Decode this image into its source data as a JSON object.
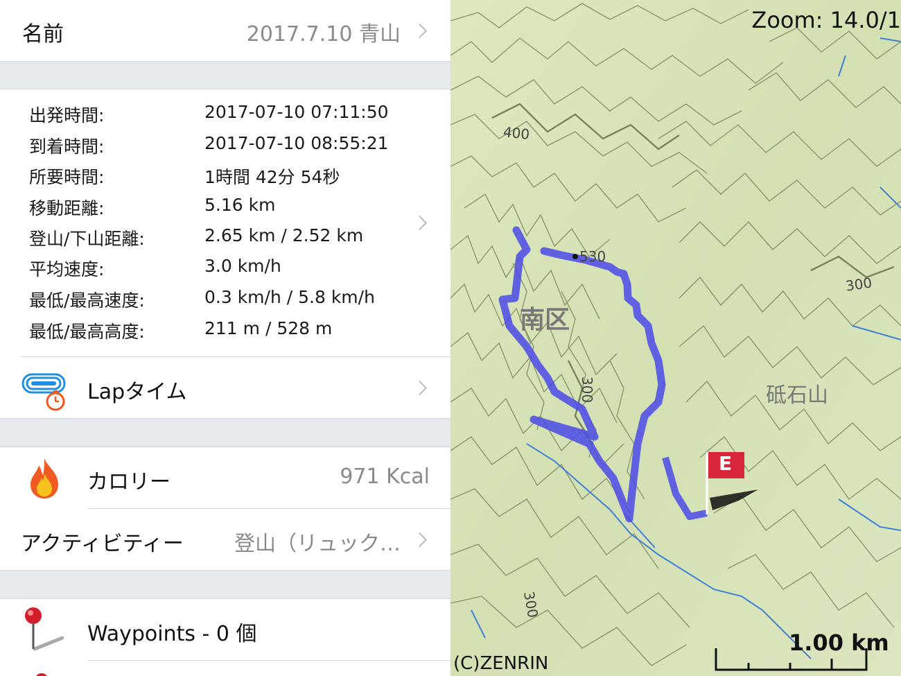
{
  "name_row": {
    "label": "名前",
    "value": "2017.7.10 青山"
  },
  "stats": [
    {
      "label": "出発時間:",
      "value": "2017-07-10 07:11:50"
    },
    {
      "label": "到着時間:",
      "value": "2017-07-10 08:55:21"
    },
    {
      "label": "所要時間:",
      "value": "1時間 42分 54秒"
    },
    {
      "label": "移動距離:",
      "value": "5.16 km"
    },
    {
      "label": "登山/下山距離:",
      "value": "2.65 km / 2.52 km"
    },
    {
      "label": "平均速度:",
      "value": "3.0 km/h"
    },
    {
      "label": "最低/最高速度:",
      "value": "0.3 km/h / 5.8 km/h"
    },
    {
      "label": "最低/最高高度:",
      "value": "211 m / 528 m"
    }
  ],
  "lap": {
    "label": "Lapタイム",
    "icon": "stopwatch-track-icon"
  },
  "calorie": {
    "label": "カロリー",
    "value": "971 Kcal",
    "icon": "flame-icon"
  },
  "activity": {
    "label": "アクティビティー",
    "value": "登山（リュック…"
  },
  "waypoints": {
    "label": "Waypoints - 0 個",
    "icon": "map-pin-icon"
  },
  "map": {
    "zoom": "Zoom: 14.0/1",
    "labels": {
      "district": "南区",
      "mountain": "砥石山",
      "peak": "530",
      "contour_400": "400",
      "contour_300_a": "300",
      "contour_300_b": "300",
      "contour_300_c": "300"
    },
    "end_flag": "E",
    "scale": "1.00 km",
    "copyright": "(C)ZENRIN",
    "colors": {
      "track": "#4f4fe6",
      "terrain": "#d6e2b8",
      "contour": "#6d7a55",
      "river": "#3f7fd8",
      "flag": "#d8263a"
    }
  }
}
